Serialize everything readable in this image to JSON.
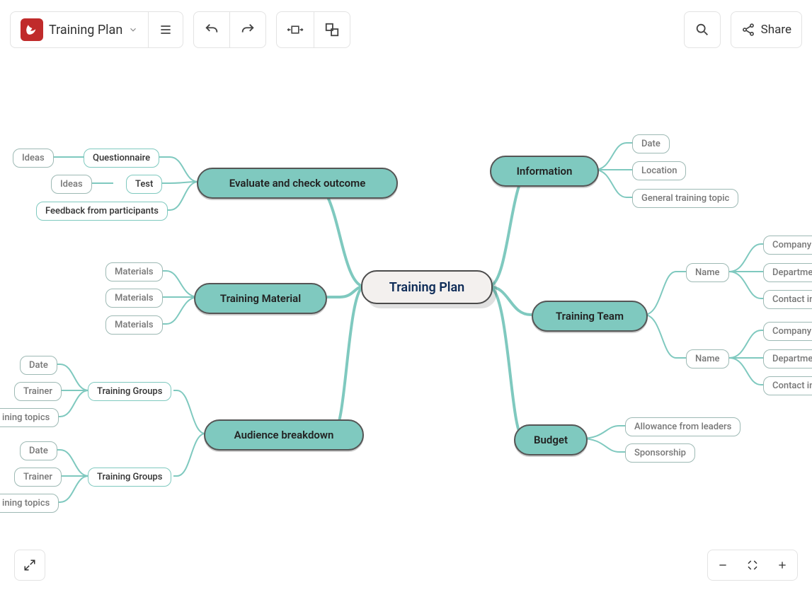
{
  "doc_title": "Training Plan",
  "toolbar": {
    "share_label": "Share"
  },
  "center": "Training Plan",
  "left_branches": {
    "evaluate": {
      "title": "Evaluate and check outcome",
      "children": [
        {
          "label": "Questionnaire",
          "sub": "Ideas"
        },
        {
          "label": "Test",
          "sub": "Ideas"
        },
        {
          "label": "Feedback from participants"
        }
      ]
    },
    "material": {
      "title": "Training Material",
      "children": [
        "Materials",
        "Materials",
        "Materials"
      ]
    },
    "audience": {
      "title": "Audience breakdown",
      "groups": [
        {
          "label": "Training Groups",
          "items": [
            "Date",
            "Trainer",
            "ining topics"
          ]
        },
        {
          "label": "Training Groups",
          "items": [
            "Date",
            "Trainer",
            "ining topics"
          ]
        }
      ]
    }
  },
  "right_branches": {
    "info": {
      "title": "Information",
      "children": [
        "Date",
        "Location",
        "General training topic"
      ]
    },
    "team": {
      "title": "Training Team",
      "members": [
        {
          "label": "Name",
          "attrs": [
            "Company",
            "Departmen",
            "Contact inf"
          ]
        },
        {
          "label": "Name",
          "attrs": [
            "Company",
            "Departmen",
            "Contact inf"
          ]
        }
      ]
    },
    "budget": {
      "title": "Budget",
      "children": [
        "Allowance from leaders",
        "Sponsorship"
      ]
    }
  }
}
